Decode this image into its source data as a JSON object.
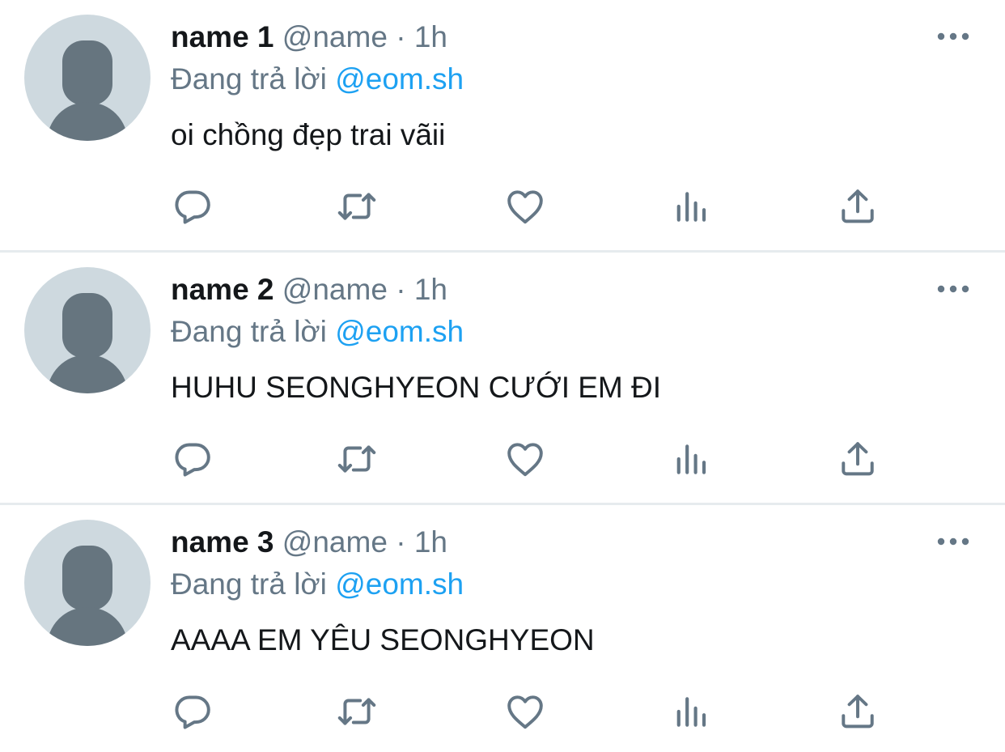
{
  "tweets": [
    {
      "display_name": "name 1",
      "handle": "@name",
      "separator": "·",
      "time": "1h",
      "reply_prefix": "Đang trả lời",
      "reply_to": "@eom.sh",
      "text": "oi chồng đẹp trai vãii"
    },
    {
      "display_name": "name 2",
      "handle": "@name",
      "separator": "·",
      "time": "1h",
      "reply_prefix": "Đang trả lời",
      "reply_to": "@eom.sh",
      "text": "HUHU SEONGHYEON CƯỚI EM ĐI"
    },
    {
      "display_name": "name 3",
      "handle": "@name",
      "separator": "·",
      "time": "1h",
      "reply_prefix": "Đang trả lời",
      "reply_to": "@eom.sh",
      "text": "AAAA EM YÊU SEONGHYEON"
    }
  ],
  "icons": {
    "reply": "reply-icon",
    "retweet": "retweet-icon",
    "like": "like-icon",
    "views": "views-icon",
    "share": "share-icon",
    "more": "more-icon"
  },
  "colors": {
    "text_primary": "#14171a",
    "text_secondary": "#657786",
    "mention": "#1da1f2",
    "icon": "#657786",
    "avatar_bg": "#ced9df",
    "divider": "#e6ebee"
  }
}
